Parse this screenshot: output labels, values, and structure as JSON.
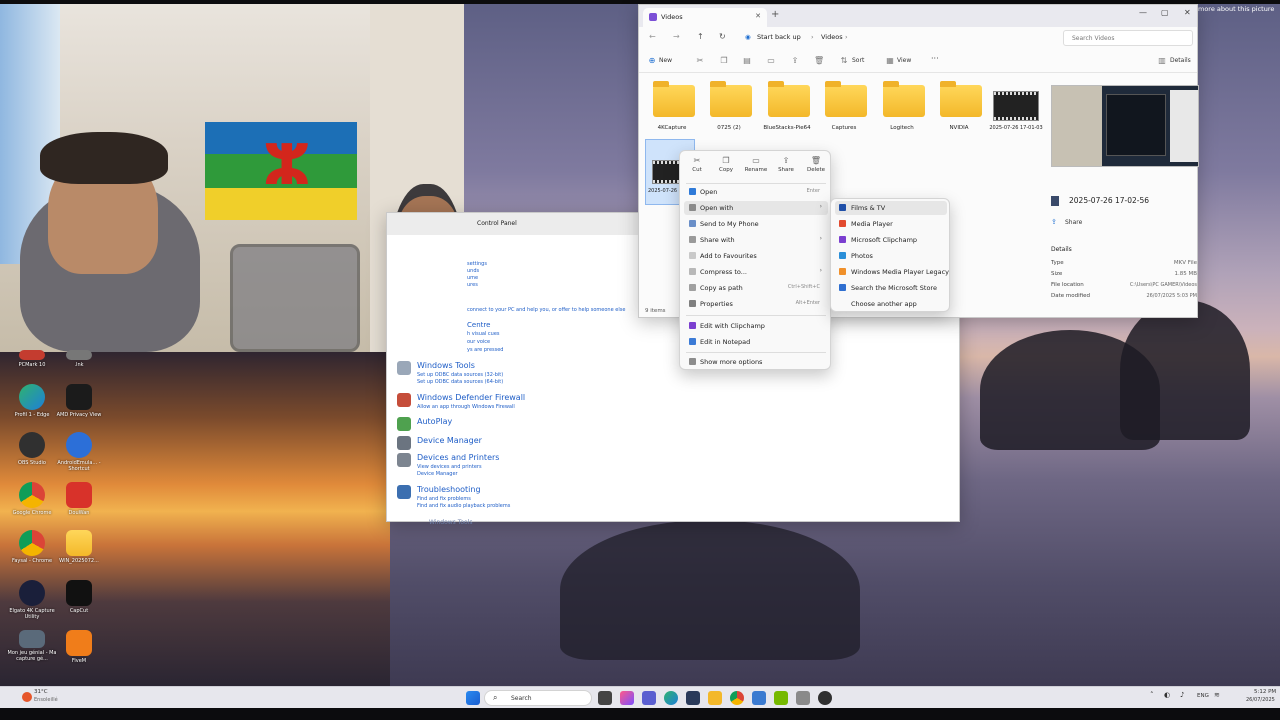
{
  "explorer": {
    "tab_title": "Videos",
    "breadcrumb": [
      "Start back up",
      "Videos"
    ],
    "search_placeholder": "Search Videos",
    "toolbar": {
      "new": "New",
      "sort": "Sort",
      "view": "View",
      "more": "···",
      "details": "Details"
    },
    "folders": [
      "4KCapture",
      "0725 (2)",
      "BlueStacks-Pie64",
      "Captures",
      "Logitech",
      "NVIDIA"
    ],
    "video_item": {
      "name": "2025-07-26 17-01-03"
    },
    "selected_item_partial": "2025-07-26 17-02-5",
    "item_count": "9 items",
    "details_pane": {
      "file_name": "2025-07-26 17-02-56",
      "share": "Share",
      "section": "Details",
      "rows": [
        {
          "label": "Type",
          "value": "MKV File"
        },
        {
          "label": "Size",
          "value": "1.85 MB"
        },
        {
          "label": "File location",
          "value": "C:\\Users\\PC GAMER\\Videos"
        },
        {
          "label": "Date modified",
          "value": "26/07/2025 5:03 PM"
        }
      ]
    }
  },
  "context_menu": {
    "quick_actions": [
      "Cut",
      "Copy",
      "Rename",
      "Share",
      "Delete"
    ],
    "items": [
      {
        "label": "Open",
        "shortcut": "Enter"
      },
      {
        "label": "Open with",
        "submenu": true
      },
      {
        "label": "Send to My Phone"
      },
      {
        "label": "Share with",
        "submenu": true
      },
      {
        "label": "Add to Favourites"
      },
      {
        "label": "Compress to...",
        "submenu": true
      },
      {
        "label": "Copy as path",
        "shortcut": "Ctrl+Shift+C"
      },
      {
        "label": "Properties",
        "shortcut": "Alt+Enter"
      },
      {
        "label": "Edit with Clipchamp"
      },
      {
        "label": "Edit in Notepad"
      },
      {
        "label": "Show more options"
      }
    ]
  },
  "open_with_submenu": [
    "Films & TV",
    "Media Player",
    "Microsoft Clipchamp",
    "Photos",
    "Windows Media Player Legacy",
    "Search the Microsoft Store",
    "Choose another app"
  ],
  "control_panel": {
    "breadcrumb": "Control Panel",
    "side_links": [
      "settings",
      "unds",
      "ume",
      "ures",
      "h visual cues",
      "our voice",
      "ys are pressed"
    ],
    "connect_hint": "connect to your PC and help you, or offer to help someone else",
    "centre_label": "Centre",
    "categories": [
      {
        "title": "Windows Tools",
        "subs": [
          "Set up ODBC data sources (32-bit)",
          "Set up ODBC data sources (64-bit)"
        ]
      },
      {
        "title": "Windows Defender Firewall",
        "subs": [
          "Allow an app through Windows Firewall"
        ]
      },
      {
        "title": "AutoPlay",
        "subs": []
      },
      {
        "title": "Device Manager",
        "subs": []
      },
      {
        "title": "Devices and Printers",
        "subs": [
          "View devices and printers",
          "Device Manager"
        ]
      },
      {
        "title": "Troubleshooting",
        "subs": [
          "Find and fix problems",
          "Find and fix audio playback problems"
        ]
      }
    ],
    "bottom_partial": "Windows Tools"
  },
  "desktop_icons": [
    {
      "label": "PCMark 10"
    },
    {
      "label": ".lnk"
    },
    {
      "label": "Profil 1 - Edge"
    },
    {
      "label": "AMD Privacy View"
    },
    {
      "label": "OBS Studio"
    },
    {
      "label": "AndroidEmula... - Shortcut"
    },
    {
      "label": "Google Chrome"
    },
    {
      "label": "DouWan"
    },
    {
      "label": "Faysal - Chrome"
    },
    {
      "label": "WIN_2025072..."
    },
    {
      "label": "Elgato 4K Capture Utility"
    },
    {
      "label": "CapCut"
    },
    {
      "label": "Mon jeu génial - Ma capture gé..."
    },
    {
      "label": "FiveM"
    }
  ],
  "taskbar": {
    "weather": "31°C",
    "weather_sub": "Ensoleillé",
    "search": "Search",
    "lang": "ENG",
    "time": "5:12 PM",
    "date": "26/07/2025"
  },
  "overlay_hint": "more about this picture"
}
